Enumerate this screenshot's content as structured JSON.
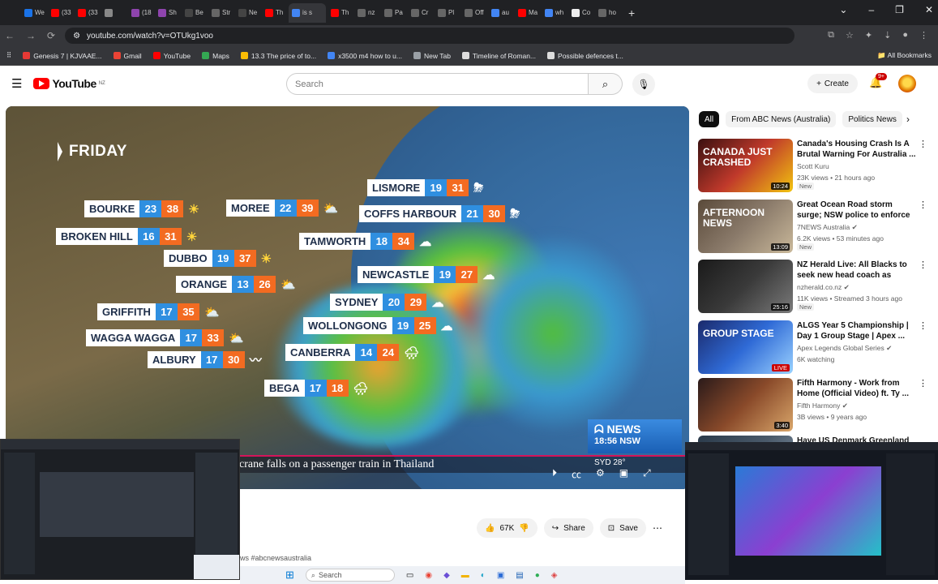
{
  "browser": {
    "tabs": [
      {
        "label": "We",
        "color": "#1a73e8"
      },
      {
        "label": "(33",
        "color": "#ff0000"
      },
      {
        "label": "(33",
        "color": "#ff0000"
      },
      {
        "label": "",
        "color": "#888888"
      },
      {
        "label": "(18",
        "color": "#8e44ad"
      },
      {
        "label": "Sh",
        "color": "#8e44ad"
      },
      {
        "label": "Be",
        "color": "#444444"
      },
      {
        "label": "Str",
        "color": "#666666"
      },
      {
        "label": "Ne",
        "color": "#444444"
      },
      {
        "label": "Th",
        "color": "#ff0000"
      },
      {
        "label": "is s",
        "color": "#4285f4"
      },
      {
        "label": "Th",
        "color": "#ff0000"
      },
      {
        "label": "nz",
        "color": "#666666"
      },
      {
        "label": "Pa",
        "color": "#666666"
      },
      {
        "label": "Cr",
        "color": "#666666"
      },
      {
        "label": "Pl",
        "color": "#666666"
      },
      {
        "label": "Off",
        "color": "#666666"
      },
      {
        "label": "au",
        "color": "#4285f4"
      },
      {
        "label": "Ma",
        "color": "#ff0000"
      },
      {
        "label": "wh",
        "color": "#4285f4"
      },
      {
        "label": "Co",
        "color": "#eeeeee"
      },
      {
        "label": "ho",
        "color": "#666666"
      }
    ],
    "url": "youtube.com/watch?v=OTUkg1voo",
    "bookmarks": [
      {
        "label": "Genesis 7 | KJVAAE...",
        "color": "#e53935"
      },
      {
        "label": "Gmail",
        "color": "#ea4335"
      },
      {
        "label": "YouTube",
        "color": "#ff0000"
      },
      {
        "label": "Maps",
        "color": "#34a853"
      },
      {
        "label": "13.3 The price of to...",
        "color": "#fbbc04"
      },
      {
        "label": "x3500 m4 how to u...",
        "color": "#4285f4"
      },
      {
        "label": "New Tab",
        "color": "#9aa0a6"
      },
      {
        "label": "Timeline of Roman...",
        "color": "#dddddd"
      },
      {
        "label": "Possible defences t...",
        "color": "#dddddd"
      }
    ],
    "all_bookmarks": "All Bookmarks"
  },
  "youtube": {
    "region": "NZ",
    "logo_text": "YouTube",
    "search_placeholder": "Search",
    "create_label": "Create",
    "notif_badge": "9+"
  },
  "video": {
    "day": "FRIDAY",
    "cities": [
      {
        "name": "LISMORE",
        "lo": "19",
        "hi": "31",
        "wx": "storm"
      },
      {
        "name": "BOURKE",
        "lo": "23",
        "hi": "38",
        "wx": "sun"
      },
      {
        "name": "MOREE",
        "lo": "22",
        "hi": "39",
        "wx": "suncloud"
      },
      {
        "name": "COFFS HARBOUR",
        "lo": "21",
        "hi": "30",
        "wx": "storm"
      },
      {
        "name": "BROKEN HILL",
        "lo": "16",
        "hi": "31",
        "wx": "sun"
      },
      {
        "name": "TAMWORTH",
        "lo": "18",
        "hi": "34",
        "wx": "cloud"
      },
      {
        "name": "DUBBO",
        "lo": "19",
        "hi": "37",
        "wx": "sun"
      },
      {
        "name": "NEWCASTLE",
        "lo": "19",
        "hi": "27",
        "wx": "cloud"
      },
      {
        "name": "ORANGE",
        "lo": "13",
        "hi": "26",
        "wx": "suncloud"
      },
      {
        "name": "SYDNEY",
        "lo": "20",
        "hi": "29",
        "wx": "cloud"
      },
      {
        "name": "GRIFFITH",
        "lo": "17",
        "hi": "35",
        "wx": "suncloud"
      },
      {
        "name": "WOLLONGONG",
        "lo": "19",
        "hi": "25",
        "wx": "cloud"
      },
      {
        "name": "WAGGA WAGGA",
        "lo": "17",
        "hi": "33",
        "wx": "suncloud"
      },
      {
        "name": "CANBERRA",
        "lo": "14",
        "hi": "24",
        "wx": "rain"
      },
      {
        "name": "ALBURY",
        "lo": "17",
        "hi": "30",
        "wx": "wind"
      },
      {
        "name": "BEGA",
        "lo": "17",
        "hi": "18",
        "wx": "rain"
      }
    ],
    "channel_bug": "NEWS",
    "channel_time": "18:56",
    "channel_state": "NSW",
    "ticker": "crane falls on a passenger train in Thailand",
    "syd_temp": "SYD 28°"
  },
  "actions": {
    "likes": "67K",
    "share": "Share",
    "save": "Save"
  },
  "description_tags": "ws #abcnewsaustralia",
  "chips": [
    "All",
    "From ABC News (Australia)",
    "Politics News"
  ],
  "recommendations": [
    {
      "title": "Canada's Housing Crash Is A Brutal Warning For Australia ...",
      "channel": "Scott Kuru",
      "meta": "23K views • 21 hours ago",
      "badge": "New",
      "duration": "10:24",
      "thumb_text": "CANADA JUST CRASHED",
      "live": "",
      "verified": false
    },
    {
      "title": "Great Ocean Road storm surge; NSW police to enforce protest ...",
      "channel": "7NEWS Australia",
      "meta": "6.2K views • 53 minutes ago",
      "badge": "New",
      "duration": "13:09",
      "thumb_text": "AFTERNOON NEWS",
      "live": "",
      "verified": true
    },
    {
      "title": "NZ Herald Live: All Blacks to seek new head coach as Scott...",
      "channel": "nzherald.co.nz",
      "meta": "11K views • Streamed 3 hours ago",
      "badge": "New",
      "duration": "25:16",
      "thumb_text": "",
      "live": "",
      "verified": true
    },
    {
      "title": "ALGS Year 5 Championship | Day 1 Group Stage | Apex ...",
      "channel": "Apex Legends Global Series",
      "meta": "6K watching",
      "badge": "",
      "duration": "",
      "thumb_text": "GROUP STAGE",
      "live": "LIVE",
      "verified": true
    },
    {
      "title": "Fifth Harmony - Work from Home (Official Video) ft. Ty ...",
      "channel": "Fifth Harmony",
      "meta": "3B views • 9 years ago",
      "badge": "",
      "duration": "3:40",
      "thumb_text": "",
      "live": "",
      "verified": true
    },
    {
      "title": "Have US Denmark Greenland",
      "channel": "",
      "meta": "",
      "badge": "",
      "duration": "",
      "thumb_text": "",
      "live": "",
      "verified": false
    }
  ],
  "taskbar": {
    "search": "Search"
  },
  "colors": {
    "yt_red": "#ff0000",
    "temp_lo": "#2f8fe0",
    "temp_hi": "#f36b21",
    "chrome_dark": "#202124"
  }
}
